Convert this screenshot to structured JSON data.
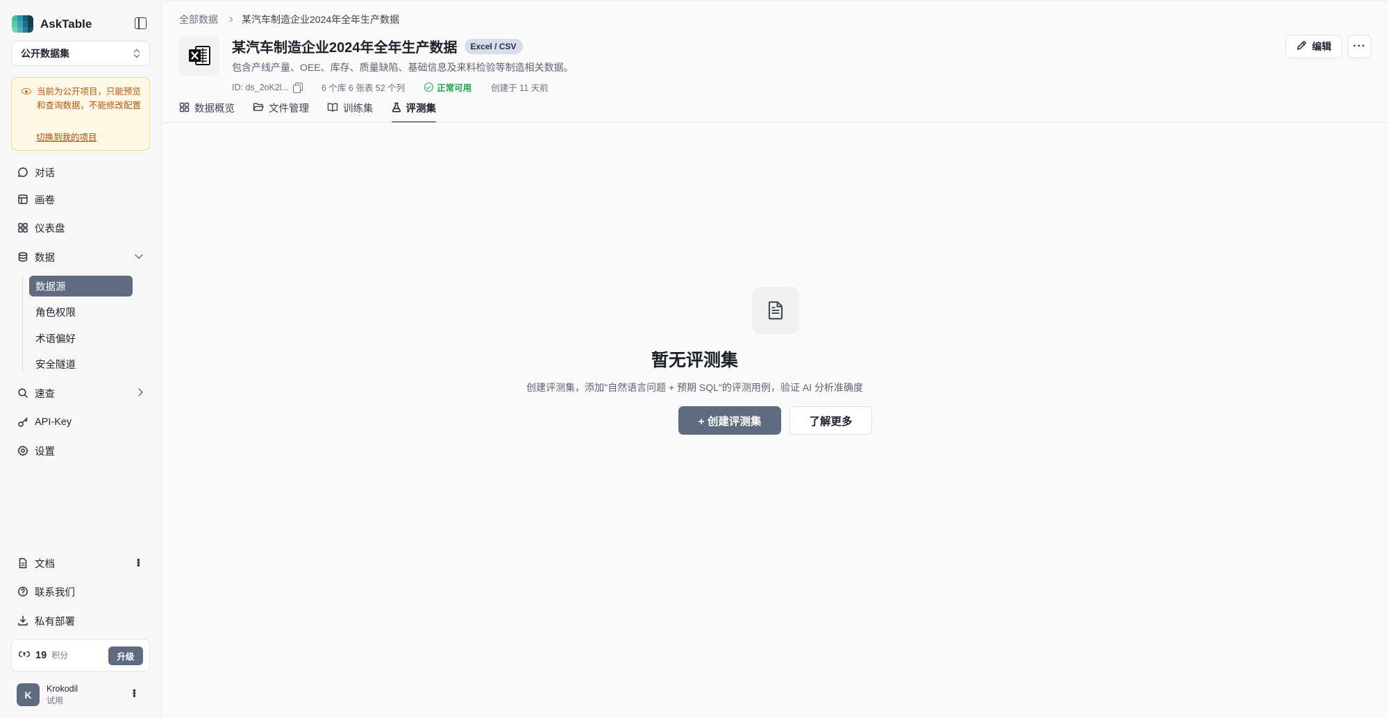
{
  "app": {
    "name": "AskTable"
  },
  "project_select": {
    "value": "公开数据集"
  },
  "notice": {
    "text": "当前为公开项目，只能预览和查询数据，不能修改配置",
    "link": "切换到我的项目"
  },
  "nav": {
    "chat": "对话",
    "canvas": "画卷",
    "dashboard": "仪表盘",
    "data": "数据",
    "data_sub": [
      "数据源",
      "角色权限",
      "术语偏好",
      "安全隧道"
    ],
    "quick": "速查",
    "apikey": "API-Key",
    "settings": "设置",
    "docs": "文档",
    "contact": "联系我们",
    "deploy": "私有部署"
  },
  "credits": {
    "value": "19",
    "unit": "积分",
    "upgrade": "升级"
  },
  "user": {
    "initial": "K",
    "name": "Krokodil",
    "plan": "试用"
  },
  "breadcrumb": {
    "root": "全部数据",
    "current": "某汽车制造企业2024年全年生产数据"
  },
  "datasource": {
    "title": "某汽车制造企业2024年全年生产数据",
    "badge": "Excel / CSV",
    "description": "包含产线产量、OEE、库存、质量缺陷、基础信息及来料检验等制造相关数据。",
    "id": "ID: ds_2oK2l...",
    "stats": "6 个库 6 张表 52 个列",
    "status": "正常可用",
    "created": "创建于 11 天前"
  },
  "actions": {
    "edit": "编辑",
    "more": "···"
  },
  "tabs": [
    "数据概览",
    "文件管理",
    "训练集",
    "评测集"
  ],
  "empty": {
    "title": "暂无评测集",
    "description": "创建评测集，添加\"自然语言问题 + 预期 SQL\"的评测用例，验证 AI 分析准确度",
    "primary": "+ 创建评测集",
    "secondary": "了解更多"
  },
  "colors": {
    "accent": "#5f6b7e",
    "success": "#17a34a",
    "warning_bg": "#fff8e6",
    "warning_text": "#b6560b"
  }
}
